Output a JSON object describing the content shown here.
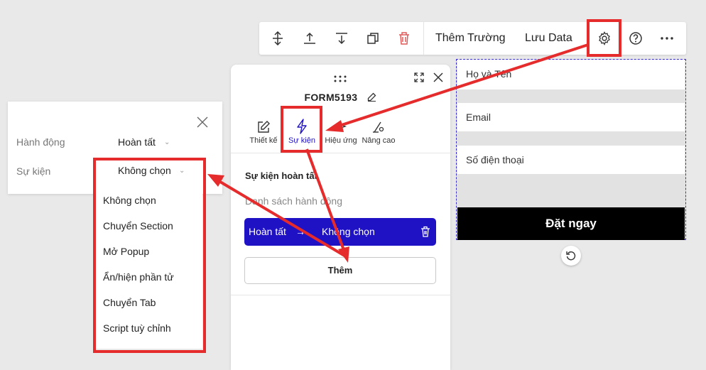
{
  "toolbar": {
    "icons": [
      "resize-vertical-icon",
      "move-up-icon",
      "move-down-icon",
      "duplicate-icon",
      "delete-icon"
    ],
    "add_field_label": "Thêm Trường",
    "save_data_label": "Lưu Data",
    "right_icons": [
      "gear-icon",
      "help-icon",
      "more-icon"
    ]
  },
  "canvas_form": {
    "fields": [
      "Họ và Tên",
      "Email",
      "Số điện thoại"
    ],
    "submit_label": "Đặt ngay"
  },
  "panel": {
    "title": "FORM5193",
    "tabs": [
      {
        "label": "Thiết kế",
        "icon": "edit-icon"
      },
      {
        "label": "Sự kiện",
        "icon": "lightning-icon"
      },
      {
        "label": "Hiệu ứng",
        "icon": "sparkle-icon"
      },
      {
        "label": "Nâng cao",
        "icon": "advanced-settings-icon"
      }
    ],
    "section_title": "Sự kiện hoàn tất",
    "section_subtitle": "Danh sách hành động",
    "action": {
      "trigger": "Hoàn tất",
      "arrow": "→",
      "value": "Không chọn"
    },
    "add_button_label": "Thêm"
  },
  "popup": {
    "action_label": "Hành động",
    "action_value": "Hoàn tất",
    "event_label": "Sự kiện",
    "event_value": "Không chọn",
    "options": [
      "Không chọn",
      "Chuyển Section",
      "Mở Popup",
      "Ẩn/hiện phần tử",
      "Chuyển Tab",
      "Script tuỳ chỉnh"
    ]
  },
  "colors": {
    "accent": "#1f12c4",
    "annotation": "#e52b2b",
    "delete": "#e05a5a"
  }
}
